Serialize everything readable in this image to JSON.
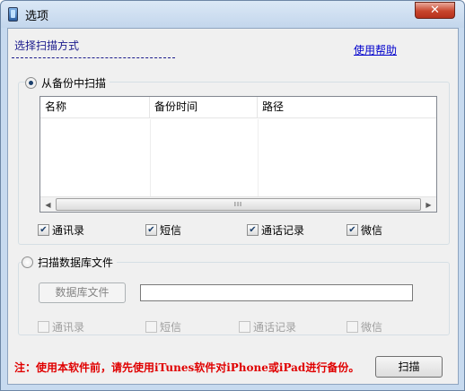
{
  "window": {
    "title": "选项",
    "close_glyph": "✕"
  },
  "header": {
    "heading": "选择扫描方式",
    "help_link": "使用帮助"
  },
  "backup_scan": {
    "radio_label": "从备份中扫描",
    "checked": true,
    "table": {
      "columns": [
        "名称",
        "备份时间",
        "路径"
      ],
      "rows": []
    },
    "scrollbar": {
      "thumb_glyph": "III"
    },
    "options": [
      {
        "label": "通讯录",
        "checked": true
      },
      {
        "label": "短信",
        "checked": true
      },
      {
        "label": "通话记录",
        "checked": true
      },
      {
        "label": "微信",
        "checked": true
      }
    ]
  },
  "db_scan": {
    "radio_label": "扫描数据库文件",
    "checked": false,
    "button_label": "数据库文件",
    "path_value": "",
    "options": [
      {
        "label": "通讯录",
        "checked": false
      },
      {
        "label": "短信",
        "checked": false
      },
      {
        "label": "通话记录",
        "checked": false
      },
      {
        "label": "微信",
        "checked": false
      }
    ]
  },
  "footer": {
    "note": "注：使用本软件前，请先使用iTunes软件对iPhone或iPad进行备份。",
    "scan_button": "扫描"
  },
  "colors": {
    "note_red": "#e00000",
    "link_blue": "#0000cc",
    "heading_navy": "#1a1a8c"
  },
  "icons": {
    "app": "phone-icon",
    "close": "close-icon",
    "scroll_left": "chevron-left-icon",
    "scroll_right": "chevron-right-icon"
  }
}
